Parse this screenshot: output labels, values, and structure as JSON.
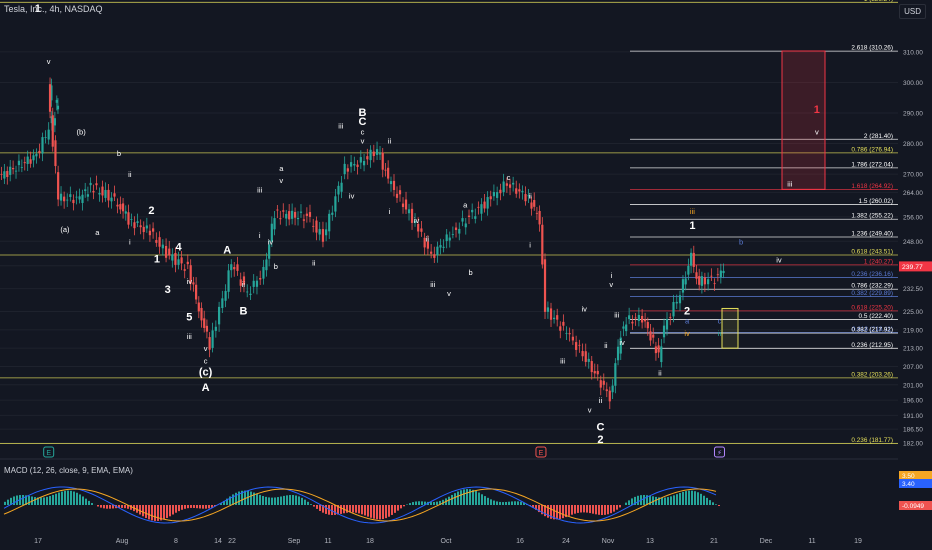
{
  "header": {
    "symbol_label": "Tesla, Inc., 4h, NASDAQ",
    "currency": "USD"
  },
  "macd_header": "MACD (12, 26, close, 9, EMA, EMA)",
  "colors": {
    "up": "#26a69a",
    "down": "#ef5350",
    "bg": "#131722",
    "fib": "#ffffff",
    "yellow_line": "#e6e05a",
    "red_line": "#f23645",
    "blue_line": "#5b7bd5"
  },
  "chart_data": [
    {
      "type": "candlestick",
      "title": "Tesla, Inc., 4h, NASDAQ",
      "y_axis_ticks": [
        310.0,
        300.0,
        290.0,
        280.0,
        270.0,
        264.0,
        256.0,
        248.0,
        240.0,
        232.5,
        225.0,
        219.0,
        213.0,
        207.0,
        201.0,
        196.0,
        191.0,
        186.5,
        182.0
      ],
      "x_axis_ticks": [
        "17",
        "Aug",
        "8",
        "14",
        "22",
        "Sep",
        "11",
        "18",
        "Oct",
        "16",
        "24",
        "Nov",
        "13",
        "21",
        "Dec",
        "11",
        "19"
      ],
      "last_price": 239.77,
      "price_series": [
        {
          "date": "Jul 10",
          "close": 269
        },
        {
          "date": "Jul 17",
          "close": 276
        },
        {
          "date": "Jul 21",
          "close": 292
        },
        {
          "date": "Jul 19",
          "close": 299
        },
        {
          "date": "Jul 21",
          "close": 262
        },
        {
          "date": "Jul 25",
          "close": 262
        },
        {
          "date": "Jul 27",
          "close": 266
        },
        {
          "date": "Aug 1",
          "close": 261
        },
        {
          "date": "Aug 3",
          "close": 255
        },
        {
          "date": "Aug 7",
          "close": 251
        },
        {
          "date": "Aug 10",
          "close": 244
        },
        {
          "date": "Aug 14",
          "close": 239
        },
        {
          "date": "Aug 16",
          "close": 226
        },
        {
          "date": "Aug 18",
          "close": 214
        },
        {
          "date": "Aug 21",
          "close": 233
        },
        {
          "date": "Aug 22",
          "close": 241
        },
        {
          "date": "Aug 25",
          "close": 231
        },
        {
          "date": "Aug 28",
          "close": 238
        },
        {
          "date": "Aug 30",
          "close": 257
        },
        {
          "date": "Sep 5",
          "close": 256
        },
        {
          "date": "Sep 8",
          "close": 249
        },
        {
          "date": "Sep 12",
          "close": 272
        },
        {
          "date": "Sep 15",
          "close": 274
        },
        {
          "date": "Sep 18",
          "close": 278
        },
        {
          "date": "Sep 20",
          "close": 268
        },
        {
          "date": "Sep 25",
          "close": 254
        },
        {
          "date": "Sep 28",
          "close": 243
        },
        {
          "date": "Oct 2",
          "close": 251
        },
        {
          "date": "Oct 5",
          "close": 256
        },
        {
          "date": "Oct 9",
          "close": 262
        },
        {
          "date": "Oct 12",
          "close": 267
        },
        {
          "date": "Oct 16",
          "close": 262
        },
        {
          "date": "Oct 18",
          "close": 255
        },
        {
          "date": "Oct 19",
          "close": 226
        },
        {
          "date": "Oct 23",
          "close": 218
        },
        {
          "date": "Oct 26",
          "close": 211
        },
        {
          "date": "Oct 31",
          "close": 197
        },
        {
          "date": "Nov 2",
          "close": 218
        },
        {
          "date": "Nov 3",
          "close": 222
        },
        {
          "date": "Nov 6",
          "close": 223
        },
        {
          "date": "Nov 8",
          "close": 215
        },
        {
          "date": "Nov 9",
          "close": 210
        },
        {
          "date": "Nov 10",
          "close": 220
        },
        {
          "date": "Nov 13",
          "close": 231
        },
        {
          "date": "Nov 15",
          "close": 243
        },
        {
          "date": "Nov 16",
          "close": 235
        },
        {
          "date": "Nov 17",
          "close": 235
        },
        {
          "date": "Nov 20",
          "close": 236
        },
        {
          "date": "Nov 21",
          "close": 239.77
        }
      ],
      "fib_levels": [
        {
          "label": "1 (326.24)",
          "price": 326.24,
          "color": "yellow"
        },
        {
          "label": "2.618 (310.26)",
          "price": 310.26,
          "color": "white"
        },
        {
          "label": "2 (281.40)",
          "price": 281.4,
          "color": "white"
        },
        {
          "label": "0.786 (276.94)",
          "price": 276.94,
          "color": "yellow"
        },
        {
          "label": "1.786 (272.04)",
          "price": 272.04,
          "color": "white"
        },
        {
          "label": "1.618 (264.92)",
          "price": 264.92,
          "color": "red"
        },
        {
          "label": "1.5 (260.02)",
          "price": 260.02,
          "color": "white"
        },
        {
          "label": "1.382 (255.22)",
          "price": 255.22,
          "color": "white"
        },
        {
          "label": "1.236 (249.40)",
          "price": 249.4,
          "color": "white"
        },
        {
          "label": "0.618 (243.51)",
          "price": 243.51,
          "color": "yellow"
        },
        {
          "label": "1 (240.27)",
          "price": 240.27,
          "color": "red"
        },
        {
          "label": "0.236 (236.16)",
          "price": 236.16,
          "color": "blue"
        },
        {
          "label": "0.786 (232.29)",
          "price": 232.29,
          "color": "white"
        },
        {
          "label": "0.382 (229.89)",
          "price": 229.89,
          "color": "blue"
        },
        {
          "label": "0.618 (225.20)",
          "price": 225.2,
          "color": "red"
        },
        {
          "label": "0.5 (222.40)",
          "price": 222.4,
          "color": "white"
        },
        {
          "label": "0.618 (218.11)",
          "price": 218.11,
          "color": "blue"
        },
        {
          "label": "0.382 (217.92)",
          "price": 217.92,
          "color": "white"
        },
        {
          "label": "0.236 (212.95)",
          "price": 212.95,
          "color": "white"
        },
        {
          "label": "0.382 (203.26)",
          "price": 203.26,
          "color": "yellow"
        },
        {
          "label": "0.236 (181.77)",
          "price": 181.77,
          "color": "yellow"
        }
      ],
      "wave_labels": [
        {
          "text": "1",
          "date": "Jul 17",
          "price": 323
        },
        {
          "text": "v",
          "date": "Jul 19",
          "price": 306
        },
        {
          "text": "(b)",
          "date": "Jul 25",
          "price": 283
        },
        {
          "text": "b",
          "date": "Aug 1",
          "price": 276
        },
        {
          "text": "ii",
          "date": "Aug 3",
          "price": 269
        },
        {
          "text": "(a)",
          "date": "Jul 22",
          "price": 251
        },
        {
          "text": "a",
          "date": "Jul 28",
          "price": 250
        },
        {
          "text": "2",
          "date": "Aug 7",
          "price": 257
        },
        {
          "text": "i",
          "date": "Aug 3",
          "price": 247
        },
        {
          "text": "4",
          "date": "Aug 12",
          "price": 245
        },
        {
          "text": "1",
          "date": "Aug 8",
          "price": 241
        },
        {
          "text": "3",
          "date": "Aug 10",
          "price": 231
        },
        {
          "text": "iv",
          "date": "Aug 14",
          "price": 234
        },
        {
          "text": "5",
          "date": "Aug 14",
          "price": 222
        },
        {
          "text": "iii",
          "date": "Aug 14",
          "price": 216
        },
        {
          "text": "v",
          "date": "Aug 17",
          "price": 212
        },
        {
          "text": "c",
          "date": "Aug 17",
          "price": 208
        },
        {
          "text": "(c)",
          "date": "Aug 17",
          "price": 204
        },
        {
          "text": "A",
          "date": "Aug 17",
          "price": 199
        },
        {
          "text": "A",
          "date": "Aug 21",
          "price": 244
        },
        {
          "text": "B",
          "date": "Aug 24",
          "price": 224
        },
        {
          "text": "ii",
          "date": "Aug 24",
          "price": 233
        },
        {
          "text": "iii",
          "date": "Aug 27",
          "price": 264
        },
        {
          "text": "a",
          "date": "Aug 31",
          "price": 271
        },
        {
          "text": "v",
          "date": "Aug 31",
          "price": 267
        },
        {
          "text": "i",
          "date": "Aug 27",
          "price": 249
        },
        {
          "text": "iv",
          "date": "Aug 29",
          "price": 247
        },
        {
          "text": "b",
          "date": "Aug 30",
          "price": 239
        },
        {
          "text": "ii",
          "date": "Sep 6",
          "price": 240
        },
        {
          "text": "iii",
          "date": "Sep 11",
          "price": 285
        },
        {
          "text": "B",
          "date": "Sep 15",
          "price": 289
        },
        {
          "text": "C",
          "date": "Sep 15",
          "price": 286
        },
        {
          "text": "c",
          "date": "Sep 15",
          "price": 283
        },
        {
          "text": "v",
          "date": "Sep 15",
          "price": 280
        },
        {
          "text": "ii",
          "date": "Sep 20",
          "price": 280
        },
        {
          "text": "iv",
          "date": "Sep 13",
          "price": 262
        },
        {
          "text": "i",
          "date": "Sep 20",
          "price": 257
        },
        {
          "text": "iv",
          "date": "Sep 25",
          "price": 254
        },
        {
          "text": "a",
          "date": "Oct 4",
          "price": 259
        },
        {
          "text": "ii",
          "date": "Sep 27",
          "price": 248
        },
        {
          "text": "iii",
          "date": "Sep 28",
          "price": 233
        },
        {
          "text": "v",
          "date": "Oct 1",
          "price": 230
        },
        {
          "text": "b",
          "date": "Oct 5",
          "price": 237
        },
        {
          "text": "c",
          "date": "Oct 12",
          "price": 268
        },
        {
          "text": "ii",
          "date": "Oct 16",
          "price": 262
        },
        {
          "text": "i",
          "date": "Oct 16",
          "price": 246
        },
        {
          "text": "iii",
          "date": "Oct 22",
          "price": 208
        },
        {
          "text": "iv",
          "date": "Oct 26",
          "price": 225
        },
        {
          "text": "i",
          "date": "Oct 31",
          "price": 236
        },
        {
          "text": "v",
          "date": "Oct 31",
          "price": 233
        },
        {
          "text": "iii",
          "date": "Nov 1",
          "price": 223
        },
        {
          "text": "ii",
          "date": "Oct 30",
          "price": 213
        },
        {
          "text": "iv",
          "date": "Nov 2",
          "price": 214
        },
        {
          "text": "v",
          "date": "Oct 27",
          "price": 192
        },
        {
          "text": "ii",
          "date": "Oct 29",
          "price": 195
        },
        {
          "text": "C",
          "date": "Oct 29",
          "price": 186
        },
        {
          "text": "2",
          "date": "Oct 29",
          "price": 182
        },
        {
          "text": "iii",
          "date": "Nov 15",
          "price": 257,
          "color": "orange"
        },
        {
          "text": "1",
          "date": "Nov 15",
          "price": 252
        },
        {
          "text": "b",
          "date": "Nov 24",
          "price": 247,
          "color": "blue"
        },
        {
          "text": "iv",
          "date": "Dec 1",
          "price": 241
        },
        {
          "text": "2",
          "date": "Nov 14",
          "price": 224
        },
        {
          "text": "a",
          "date": "Nov 14",
          "price": 221,
          "color": "blue"
        },
        {
          "text": "iv",
          "date": "Nov 14",
          "price": 217,
          "color": "orange"
        },
        {
          "text": "ii",
          "date": "Nov 9",
          "price": 204
        },
        {
          "text": "c",
          "date": "Nov 20",
          "price": 221,
          "color": "blue"
        },
        {
          "text": "ii",
          "date": "Nov 20",
          "price": 217,
          "color": "green"
        },
        {
          "text": "1",
          "date": "Dec 8",
          "price": 290,
          "color": "red"
        },
        {
          "text": "v",
          "date": "Dec 8",
          "price": 283
        },
        {
          "text": "iii",
          "date": "Dec 3",
          "price": 266
        }
      ]
    },
    {
      "type": "bar",
      "title": "MACD (12, 26, close, 9, EMA, EMA)",
      "y_axis_ticks": [
        3.5,
        3.4,
        -0.0949
      ],
      "y_tick_colors": [
        "#f5a623",
        "#2962ff",
        "#ef5350"
      ],
      "values_note": "histogram + MACD/signal lines"
    }
  ],
  "event_markers": [
    {
      "icon": "earnings-icon",
      "label": "E",
      "date": "Jul 19",
      "color": "#26a69a"
    },
    {
      "icon": "earnings-icon",
      "label": "E",
      "date": "Oct 18",
      "color": "#ef5350"
    },
    {
      "icon": "lightning-icon",
      "label": "⚡",
      "date": "Nov 20",
      "color": "#b388ff"
    }
  ]
}
